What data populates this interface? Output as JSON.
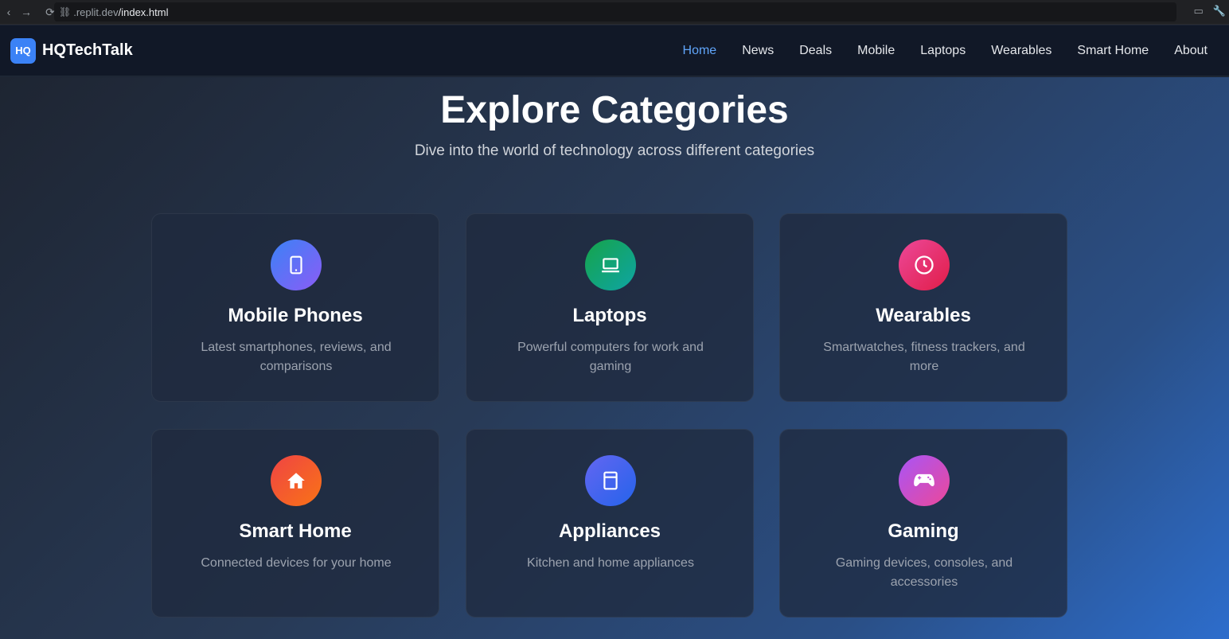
{
  "browser": {
    "url_host": ".replit.dev",
    "url_path": "/index.html"
  },
  "header": {
    "logo_text": "HQ",
    "brand": "HQTechTalk",
    "nav": [
      {
        "label": "Home",
        "active": true
      },
      {
        "label": "News"
      },
      {
        "label": "Deals"
      },
      {
        "label": "Mobile"
      },
      {
        "label": "Laptops"
      },
      {
        "label": "Wearables"
      },
      {
        "label": "Smart Home"
      },
      {
        "label": "About"
      }
    ]
  },
  "main": {
    "title": "Explore Categories",
    "subtitle": "Dive into the world of technology across different categories",
    "categories": [
      {
        "title": "Mobile Phones",
        "desc": "Latest smartphones, reviews, and comparisons",
        "icon": "phone-icon",
        "colors": [
          "#3b82f6",
          "#8b5cf6"
        ]
      },
      {
        "title": "Laptops",
        "desc": "Powerful computers for work and gaming",
        "icon": "laptop-icon",
        "colors": [
          "#16a34a",
          "#0ea5a4"
        ]
      },
      {
        "title": "Wearables",
        "desc": "Smartwatches, fitness trackers, and more",
        "icon": "clock-icon",
        "colors": [
          "#ec4899",
          "#e11d48"
        ]
      },
      {
        "title": "Smart Home",
        "desc": "Connected devices for your home",
        "icon": "home-icon",
        "colors": [
          "#ef4444",
          "#f97316"
        ]
      },
      {
        "title": "Appliances",
        "desc": "Kitchen and home appliances",
        "icon": "appliance-icon",
        "colors": [
          "#6366f1",
          "#2563eb"
        ]
      },
      {
        "title": "Gaming",
        "desc": "Gaming devices, consoles, and accessories",
        "icon": "gamepad-icon",
        "colors": [
          "#a855f7",
          "#ec4899"
        ]
      }
    ]
  }
}
